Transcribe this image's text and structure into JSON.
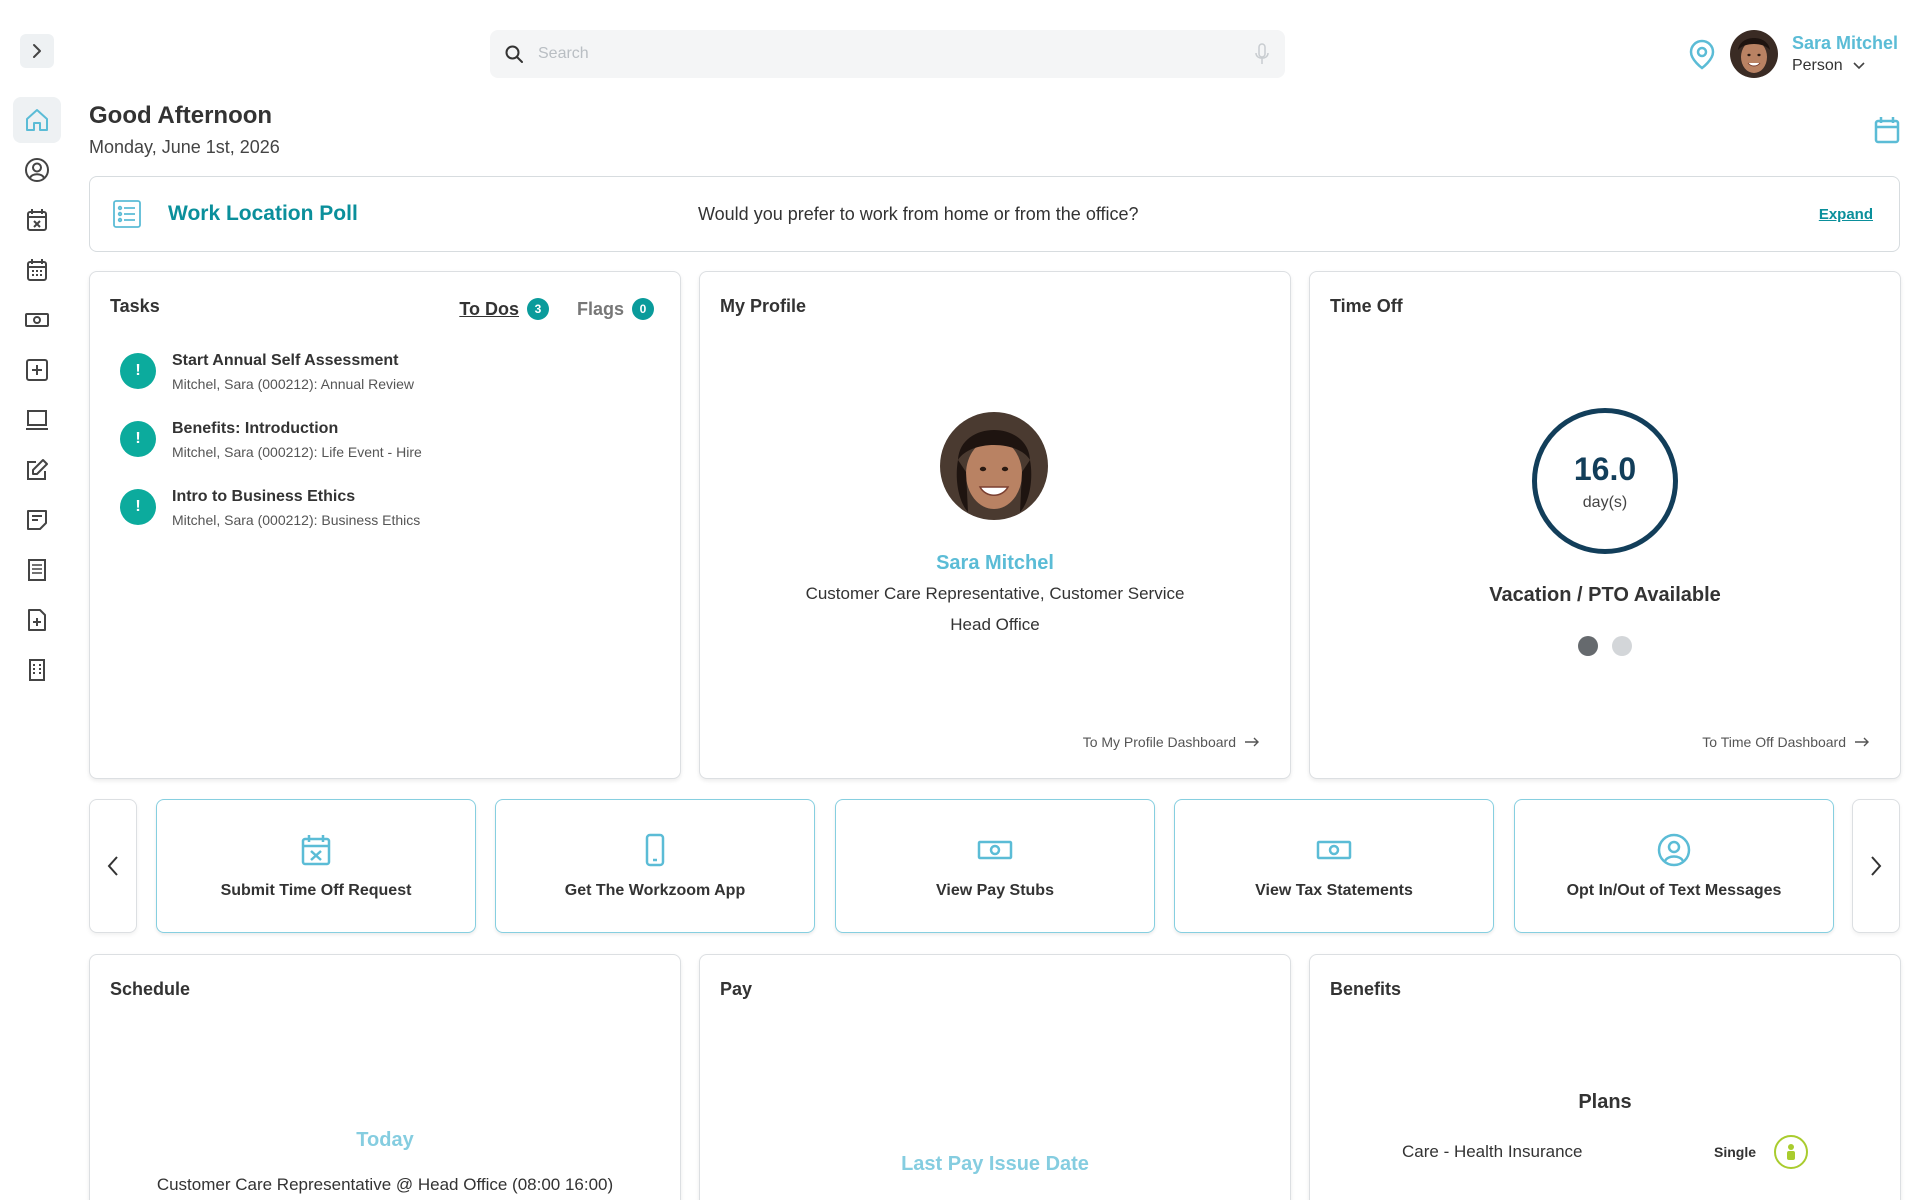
{
  "sidebar": {
    "items": [
      {
        "icon": "home-icon",
        "active": true
      },
      {
        "icon": "user-circle-icon"
      },
      {
        "icon": "calendar-x-icon"
      },
      {
        "icon": "calendar-grid-icon"
      },
      {
        "icon": "money-icon"
      },
      {
        "icon": "plus-square-icon"
      },
      {
        "icon": "monitor-icon"
      },
      {
        "icon": "edit-icon"
      },
      {
        "icon": "note-icon"
      },
      {
        "icon": "document-list-icon"
      },
      {
        "icon": "file-plus-icon"
      },
      {
        "icon": "building-icon"
      }
    ]
  },
  "search": {
    "placeholder": "Search"
  },
  "user": {
    "name": "Sara Mitchel",
    "role": "Person"
  },
  "greeting": {
    "title": "Good Afternoon",
    "date": "Monday, June 1st, 2026"
  },
  "poll": {
    "title": "Work Location Poll",
    "question": "Would you prefer to work from home or from the office?",
    "expand_label": "Expand"
  },
  "tasks": {
    "title": "Tasks",
    "tabs": [
      {
        "label": "To Dos",
        "count": "3",
        "active": true
      },
      {
        "label": "Flags",
        "count": "0",
        "active": false
      }
    ],
    "items": [
      {
        "title": "Start Annual Self Assessment",
        "subtitle": "Mitchel, Sara (000212): Annual Review"
      },
      {
        "title": "Benefits: Introduction",
        "subtitle": "Mitchel, Sara (000212): Life Event - Hire"
      },
      {
        "title": "Intro to Business Ethics",
        "subtitle": "Mitchel, Sara (000212): Business Ethics"
      }
    ]
  },
  "profile": {
    "title": "My Profile",
    "name": "Sara Mitchel",
    "position": "Customer Care Representative, Customer Service",
    "location": "Head Office",
    "link_label": "To My Profile Dashboard"
  },
  "time_off": {
    "title": "Time Off",
    "value": "16.0",
    "unit": "day(s)",
    "label": "Vacation / PTO Available",
    "link_label": "To Time Off Dashboard",
    "carousel_pages": 2,
    "carousel_active": 0
  },
  "quick_links": [
    {
      "label": "Submit Time Off Request",
      "icon": "calendar-x-icon"
    },
    {
      "label": "Get The Workzoom App",
      "icon": "phone-icon"
    },
    {
      "label": "View Pay Stubs",
      "icon": "money-icon"
    },
    {
      "label": "View Tax Statements",
      "icon": "money-icon"
    },
    {
      "label": "Opt In/Out of Text Messages",
      "icon": "user-circle-icon"
    }
  ],
  "schedule": {
    "title": "Schedule",
    "day_label": "Today",
    "entry": "Customer Care Representative @ Head Office (08:00 16:00)"
  },
  "pay": {
    "title": "Pay",
    "label": "Last Pay Issue Date"
  },
  "benefits": {
    "title": "Benefits",
    "plans_title": "Plans",
    "plans": [
      {
        "name": "Care - Health Insurance",
        "coverage": "Single",
        "icon": "person-badge-icon"
      }
    ]
  },
  "colors": {
    "accent": "#5bbcd6",
    "teal": "#0a8f9b",
    "alert": "#0cab9d",
    "ring": "#123e5a",
    "benefit_badge": "#a9cc2e"
  }
}
